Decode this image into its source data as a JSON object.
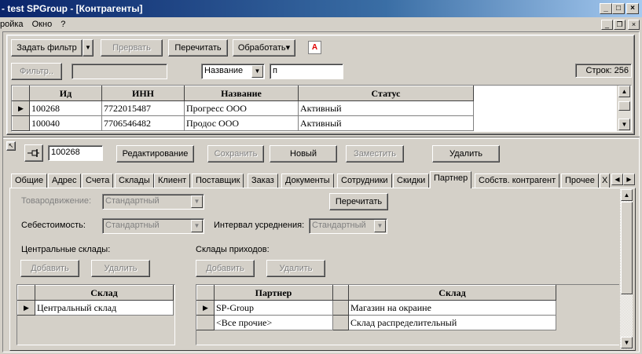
{
  "window": {
    "title": "- test SPGroup - [Контрагенты]",
    "min_glyph": "_",
    "max_glyph": "□",
    "close_glyph": "×"
  },
  "menu": {
    "items": [
      "ройка",
      "Окно",
      "?"
    ]
  },
  "mdi": {
    "min": "_",
    "restore": "❐",
    "close": "×"
  },
  "toolbar": {
    "filter_button": "Задать фильтр",
    "filter_dropdown": "▼",
    "stop_button": "Прервать",
    "reread_button": "Перечитать",
    "process_button": "Обработать",
    "process_arrow": "▾",
    "a_icon": "A",
    "filter_small_button": "Фильтр..",
    "filter_value": "",
    "field_select": "Название",
    "search_value": "п",
    "rows_label": "Строк: 256"
  },
  "main_grid": {
    "columns": [
      "Ид",
      "ИНН",
      "Название",
      "Статус"
    ],
    "rows": [
      [
        "100268",
        "7722015487",
        "Прогресс ООО",
        "Активный"
      ],
      [
        "100040",
        "7706546482",
        "Продос ООО",
        "Активный"
      ]
    ],
    "row_indicator": "▶"
  },
  "detail_bar": {
    "pin_icon": "pin-icon",
    "id_value": "100268",
    "edit_button": "Редактирование",
    "save_button": "Сохранить",
    "new_button": "Новый",
    "replace_button": "Заместить",
    "delete_button": "Удалить"
  },
  "tabs": [
    "Общие",
    "Адрес",
    "Счета",
    "Склады",
    "Клиент",
    "Поставщик",
    "Заказ",
    "Документы",
    "Сотрудники",
    "Скидки",
    "Партнер",
    "Собств. контрагент",
    "Прочее",
    "Х"
  ],
  "active_tab": "Партнер",
  "partner": {
    "goods_label": "Товародвижение:",
    "goods_value": "Стандартный",
    "cost_label": "Себестоимость:",
    "cost_value": "Стандартный",
    "interval_label": "Интервал усреднения:",
    "interval_value": "Стандартный",
    "reread_button": "Перечитать",
    "central_label": "Центральные склады:",
    "income_label": "Склады приходов:",
    "add_button": "Добавить",
    "delete_button": "Удалить",
    "central_grid": {
      "columns": [
        "Склад"
      ],
      "rows": [
        [
          "Центральный склад"
        ]
      ]
    },
    "income_grid": {
      "columns": [
        "Партнер",
        "Склад"
      ],
      "rows": [
        [
          "SP-Group",
          "Магазин на окраине"
        ],
        [
          "<Все прочие>",
          "Склад распределительный"
        ]
      ]
    }
  }
}
